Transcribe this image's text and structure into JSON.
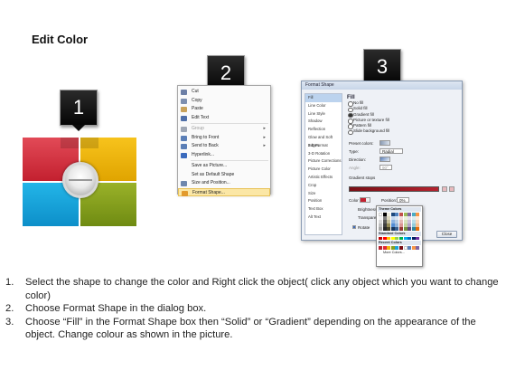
{
  "title": "Edit Color",
  "steps": [
    "1",
    "2",
    "3"
  ],
  "context_menu": {
    "items": [
      {
        "label": "Cut",
        "icon": "scissors-icon",
        "color": "#6c7fa6"
      },
      {
        "label": "Copy",
        "icon": "copy-icon",
        "color": "#7d8fb0"
      },
      {
        "label": "Paste",
        "icon": "clipboard-icon",
        "color": "#c9a25a"
      },
      {
        "label": "Edit Text",
        "icon": "edit-text-icon",
        "color": "#4f6fa8"
      },
      {
        "label": "Group",
        "icon": "group-icon",
        "color": "#9fa7b5"
      },
      {
        "label": "Bring to Front",
        "icon": "bring-front-icon",
        "color": "#5b7fb7"
      },
      {
        "label": "Send to Back",
        "icon": "send-back-icon",
        "color": "#5b7fb7"
      },
      {
        "label": "Hyperlink...",
        "icon": "hyperlink-icon",
        "color": "#3b6bbd"
      },
      {
        "label": "Save as Picture...",
        "icon": "",
        "color": ""
      },
      {
        "label": "Set as Default Shape",
        "icon": "",
        "color": ""
      },
      {
        "label": "Size and Position...",
        "icon": "size-position-icon",
        "color": "#6f87ad"
      },
      {
        "label": "Format Shape...",
        "icon": "format-shape-icon",
        "color": "#e29a2c"
      }
    ]
  },
  "format_dialog": {
    "title": "Format Shape",
    "sidebar": [
      "Fill",
      "Line Color",
      "Line Style",
      "Shadow",
      "Reflection",
      "Glow and Soft Edges",
      "3-D Format",
      "3-D Rotation",
      "Picture Corrections",
      "Picture Color",
      "Artistic Effects",
      "Crop",
      "Size",
      "Position",
      "Text Box",
      "Alt Text"
    ],
    "fill_heading": "Fill",
    "fill_options": [
      "No fill",
      "Solid fill",
      "Gradient fill",
      "Picture or texture fill",
      "Pattern fill",
      "Slide background fill"
    ],
    "preset_colors_label": "Preset colors:",
    "type_label": "Type:",
    "type_value": "Radial",
    "direction_label": "Direction:",
    "angle_label": "Angle:",
    "angle_value": "90°",
    "gradient_stops_label": "Gradient stops",
    "color_label": "Color",
    "position_label": "Position:",
    "position_value": "0%",
    "brightness_label": "Brightness",
    "transparency_label": "Transparency",
    "rotate_label": "Rotate",
    "palette": {
      "theme_label": "Theme Colors",
      "standard_label": "Standard Colors",
      "recent_label": "Recent Colors",
      "more_label": "More Colors..."
    },
    "close_label": "Close"
  },
  "instructions": [
    {
      "num": "1.",
      "text": "Select the shape to change the color and Right click the object( click any object which you want to change color)"
    },
    {
      "num": "2.",
      "text": "Choose Format Shape in the dialog box."
    },
    {
      "num": "3.",
      "text": "Choose “Fill” in the Format Shape box then “Solid” or “Gradient” depending on the appearance of the object. Change colour as shown in the picture."
    }
  ],
  "colors": {
    "red": "#d12d3b",
    "yellow": "#f0b40c",
    "blue": "#1aa3db",
    "green": "#86a01e",
    "highlight": "#fbe7a6"
  }
}
